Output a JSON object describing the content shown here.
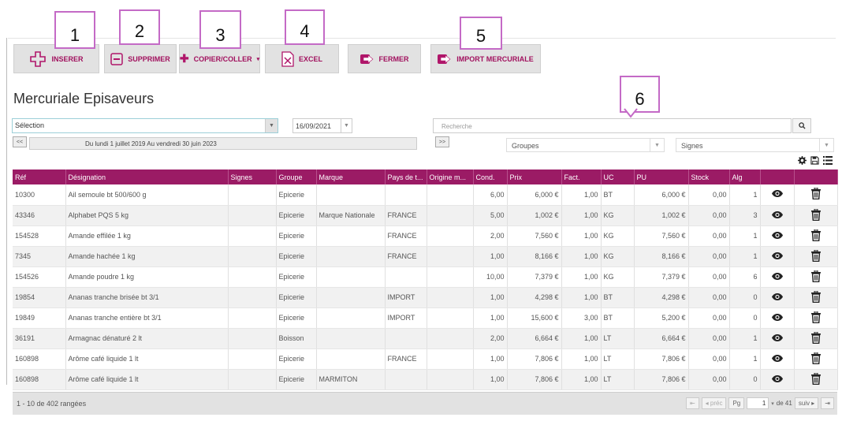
{
  "toolbar": {
    "insert_label": "INSERER",
    "delete_label": "SUPPRIMER",
    "copy_label": "COPIER/COLLER",
    "excel_label": "EXCEL",
    "close_label": "FERMER",
    "import_label": "IMPORT MERCURIALE"
  },
  "callouts": [
    "1",
    "2",
    "3",
    "4",
    "5",
    "6"
  ],
  "page_title": "Mercuriale Episaveurs",
  "filters": {
    "selection_value": "Sélection",
    "date_value": "16/09/2021",
    "search_placeholder": "Recherche",
    "prev_label": "<<",
    "next_label": ">>",
    "period_text": "Du lundi 1 juillet 2019 Au vendredi 30 juin 2023",
    "groups_value": "Groupes",
    "signs_value": "Signes"
  },
  "table": {
    "headers": [
      "Réf",
      "Désignation",
      "Signes",
      "Groupe",
      "Marque",
      "Pays de t...",
      "Origine m...",
      "Cond.",
      "Prix",
      "Fact.",
      "UC",
      "PU",
      "Stock",
      "Alg",
      "",
      ""
    ],
    "rows": [
      [
        "10300",
        "Ail semoule bt 500/600 g",
        "",
        "Epicerie",
        "",
        "",
        "",
        "6,00",
        "6,000 €",
        "1,00",
        "BT",
        "6,000 €",
        "0,00",
        "1"
      ],
      [
        "43346",
        "Alphabet PQS 5 kg",
        "",
        "Epicerie",
        "Marque Nationale",
        "FRANCE",
        "",
        "5,00",
        "1,002 €",
        "1,00",
        "KG",
        "1,002 €",
        "0,00",
        "3"
      ],
      [
        "154528",
        "Amande effilée 1 kg",
        "",
        "Epicerie",
        "",
        "FRANCE",
        "",
        "2,00",
        "7,560 €",
        "1,00",
        "KG",
        "7,560 €",
        "0,00",
        "1"
      ],
      [
        "7345",
        "Amande hachée 1 kg",
        "",
        "Epicerie",
        "",
        "FRANCE",
        "",
        "1,00",
        "8,166 €",
        "1,00",
        "KG",
        "8,166 €",
        "0,00",
        "1"
      ],
      [
        "154526",
        "Amande poudre 1 kg",
        "",
        "Epicerie",
        "",
        "",
        "",
        "10,00",
        "7,379 €",
        "1,00",
        "KG",
        "7,379 €",
        "0,00",
        "6"
      ],
      [
        "19854",
        "Ananas tranche brisée bt 3/1",
        "",
        "Epicerie",
        "",
        "IMPORT",
        "",
        "1,00",
        "4,298 €",
        "1,00",
        "BT",
        "4,298 €",
        "0,00",
        "0"
      ],
      [
        "19849",
        "Ananas tranche entière bt 3/1",
        "",
        "Epicerie",
        "",
        "IMPORT",
        "",
        "1,00",
        "15,600 €",
        "3,00",
        "BT",
        "5,200 €",
        "0,00",
        "0"
      ],
      [
        "36191",
        "Armagnac dénaturé 2 lt",
        "",
        "Boisson",
        "",
        "",
        "",
        "2,00",
        "6,664 €",
        "1,00",
        "LT",
        "6,664 €",
        "0,00",
        "1"
      ],
      [
        "160898",
        "Arôme café liquide 1 lt",
        "",
        "Epicerie",
        "",
        "FRANCE",
        "",
        "1,00",
        "7,806 €",
        "1,00",
        "LT",
        "7,806 €",
        "0,00",
        "1"
      ],
      [
        "160898",
        "Arôme café liquide 1 lt",
        "",
        "Epicerie",
        "MARMITON",
        "",
        "",
        "1,00",
        "7,806 €",
        "1,00",
        "LT",
        "7,806 €",
        "0,00",
        "0"
      ]
    ]
  },
  "pager": {
    "summary": "1 - 10 de 402 rangées",
    "prev_label": "préc",
    "page_label": "Pg",
    "page_value": "1",
    "of_label": "de 41",
    "next_label": "suiv"
  },
  "colors": {
    "accent": "#9b1b65",
    "callout_border": "#c46ac6"
  }
}
